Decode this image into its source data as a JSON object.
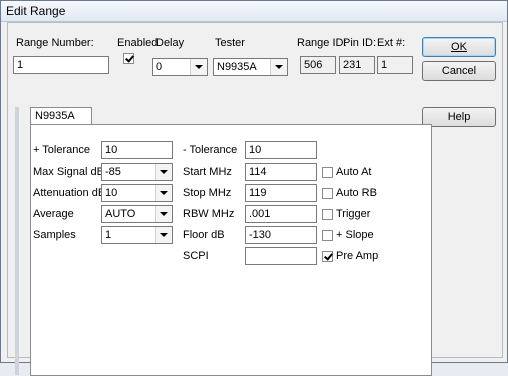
{
  "window": {
    "title": "Edit Range"
  },
  "header": {
    "range_number_label": "Range Number:",
    "range_number_value": "1",
    "enabled_label": "Enabled",
    "enabled_checked": true,
    "delay_label": "Delay",
    "delay_value": "0",
    "tester_label": "Tester",
    "tester_value": "N9935A",
    "range_id_label": "Range ID:",
    "range_id_value": "506",
    "pin_id_label": "Pin ID:",
    "pin_id_value": "231",
    "ext_label": "Ext #:",
    "ext_value": "1"
  },
  "buttons": {
    "ok": "OK",
    "cancel": "Cancel",
    "help": "Help"
  },
  "tab": {
    "label": "N9935A"
  },
  "left_fields": {
    "plus_tolerance_label": "+ Tolerance",
    "plus_tolerance_value": "10",
    "max_signal_label": "Max Signal dB",
    "max_signal_value": "-85",
    "attenuation_label": "Attenuation dB",
    "attenuation_value": "10",
    "average_label": "Average",
    "average_value": "AUTO",
    "samples_label": "Samples",
    "samples_value": "1"
  },
  "mid_fields": {
    "minus_tolerance_label": "- Tolerance",
    "minus_tolerance_value": "10",
    "start_mhz_label": "Start MHz",
    "start_mhz_value": "114",
    "stop_mhz_label": "Stop MHz",
    "stop_mhz_value": "119",
    "rbw_mhz_label": "RBW MHz",
    "rbw_mhz_value": ".001",
    "floor_db_label": "Floor dB",
    "floor_db_value": "-130",
    "scpi_label": "SCPI",
    "scpi_value": ""
  },
  "checkboxes": {
    "auto_at": {
      "label": "Auto At",
      "checked": false
    },
    "auto_rb": {
      "label": "Auto RB",
      "checked": false
    },
    "trigger": {
      "label": "Trigger",
      "checked": false
    },
    "plus_slope": {
      "label": "+ Slope",
      "checked": false
    },
    "pre_amp": {
      "label": "Pre Amp",
      "checked": true
    }
  }
}
